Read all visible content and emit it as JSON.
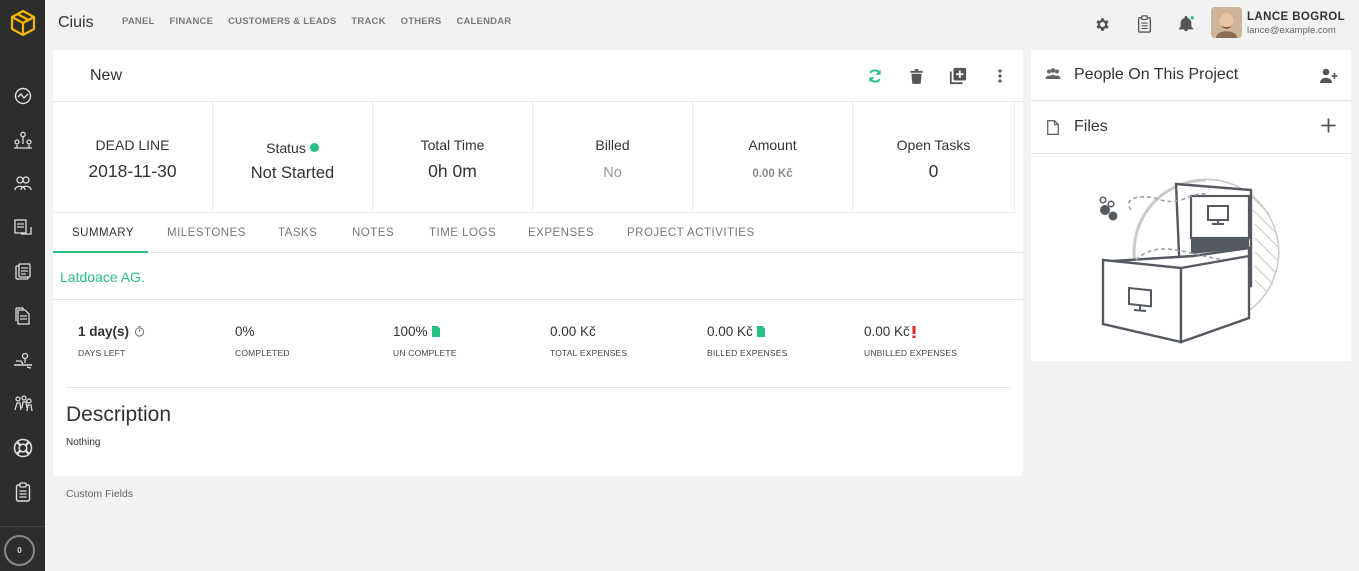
{
  "app": {
    "title": "Ciuis"
  },
  "topnav": [
    "PANEL",
    "FINANCE",
    "CUSTOMERS & LEADS",
    "TRACK",
    "OTHERS",
    "CALENDAR"
  ],
  "user": {
    "name": "LANCE BOGROL",
    "email": "lance@example.com"
  },
  "project": {
    "title": "New"
  },
  "stats": [
    {
      "label": "DEAD LINE",
      "value": "2018-11-30"
    },
    {
      "label": "Status",
      "value": "Not Started"
    },
    {
      "label": "Total Time",
      "value": "0h 0m"
    },
    {
      "label": "Billed",
      "value": "No"
    },
    {
      "label": "Amount",
      "value": "0.00 Kč"
    },
    {
      "label": "Open Tasks",
      "value": "0"
    }
  ],
  "tabs": [
    "SUMMARY",
    "MILESTONES",
    "TASKS",
    "NOTES",
    "TIME LOGS",
    "EXPENSES",
    "PROJECT ACTIVITIES"
  ],
  "customer": "Latdoace AG.",
  "metrics": [
    {
      "value": "1 day(s)",
      "label": "DAYS LEFT"
    },
    {
      "value": "0%",
      "label": "COMPLETED"
    },
    {
      "value": "100%",
      "label": "UN COMPLETE"
    },
    {
      "value": "0.00 Kč",
      "label": "TOTAL EXPENSES"
    },
    {
      "value": "0.00 Kč",
      "label": "BILLED EXPENSES"
    },
    {
      "value": "0.00 Kč",
      "label": "UNBILLED EXPENSES"
    }
  ],
  "description": {
    "title": "Description",
    "text": "Nothing"
  },
  "custom_fields": "Custom Fields",
  "right_panel": {
    "people_title": "People On This Project",
    "files_title": "Files"
  },
  "sidebar": {
    "notification_count": "0"
  },
  "colors": {
    "accent": "#26c281",
    "logo": "#f5b800",
    "sidebar": "#2d2d2d",
    "alert": "#e02222"
  }
}
